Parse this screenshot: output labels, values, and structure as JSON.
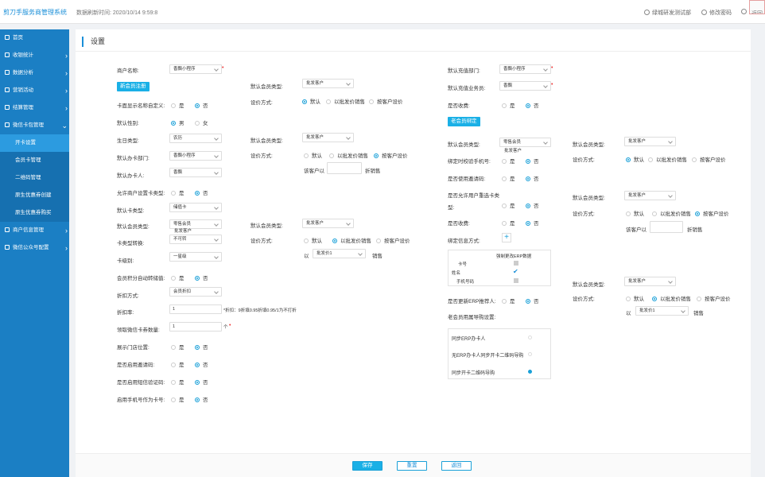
{
  "header": {
    "brand": "剪刀手服务商管理系统",
    "refresh": "数据刷新时间: 2020/10/14 9:59:8",
    "user": "绿城研发测试部",
    "change_pwd": "修改密码",
    "back": "返回"
  },
  "sidebar": {
    "items": [
      {
        "label": "首页"
      },
      {
        "label": "收银统计"
      },
      {
        "label": "数据分析"
      },
      {
        "label": "营销活动"
      },
      {
        "label": "结算管理"
      },
      {
        "label": "微信卡包管理"
      },
      {
        "label": "开卡设置"
      },
      {
        "label": "会员卡管理"
      },
      {
        "label": "二维码管理"
      },
      {
        "label": "原生优惠券创建"
      },
      {
        "label": "原生优惠券购买"
      },
      {
        "label": "商户信息管理"
      },
      {
        "label": "微信公众号配置"
      }
    ]
  },
  "page": {
    "title": "设置"
  },
  "form": {
    "c1": {
      "merchant_label": "商户名称:",
      "merchant_value": "香飘小程序",
      "new_member_tag": "新会员注册",
      "custom_title_label": "卡面显示名称自定义:",
      "yes": "是",
      "no": "否",
      "gender_label": "默认性别:",
      "male": "男",
      "female": "女",
      "birthday_label": "生日类型:",
      "birthday_value": "农历",
      "dept_label": "默认办卡部门:",
      "dept_value": "香飘小程序",
      "person_label": "默认办卡人:",
      "person_value": "香飘",
      "allow_type_label": "允许商户设置卡类型:",
      "card_type_label": "默认卡类型:",
      "card_type_value": "储值卡",
      "member_type_label": "默认会员类型:",
      "member_type_value": "零售会员",
      "member_type_overlay": "批发客户",
      "card_convert_label": "卡类型转换:",
      "card_convert_value": "不可转",
      "card_level_label": "卡级别:",
      "card_level_value": "一星级",
      "points_label": "会员积分自动转储值:",
      "discount_mode_label": "折扣方式:",
      "discount_mode_value": "会员折扣",
      "discount_rate_label": "折扣率:",
      "discount_rate_value": "1",
      "discount_rate_hint": "*折扣：9折填0.95折填0.95/1为不打折",
      "wx_count_label": "领取微信卡券数量:",
      "wx_count_value": "1",
      "wx_count_unit": "个",
      "show_store_label": "展示门店位置:",
      "invite_label": "是否启用邀请码:",
      "sms_label": "是否启用短信验证码:",
      "phone_card_label": "启用手机号作为卡号:"
    },
    "c2": {
      "mt_label": "默认会员类型:",
      "mt_value": "批发客户",
      "price_label": "设价方式:",
      "opt_default": "默认",
      "opt_wholesale": "以批发价销售",
      "opt_customer": "按客户设价",
      "by_customer_prefix": "该客户以",
      "discount_suffix": "折销售",
      "to_label": "以",
      "to_value": "批发价1",
      "sale_suffix": "销售"
    },
    "c3": {
      "dept_label": "默认充值部门:",
      "dept_value": "香飘小程序",
      "staff_label": "默认充值业务员:",
      "staff_value": "香飘",
      "fee_label": "是否收费:",
      "old_member_tag": "老会员绑定",
      "mt_label": "默认会员类型:",
      "mt_value": "零售会员",
      "mt_overlay": "批发客户",
      "bind_phone_label": "绑定时校验手机号:",
      "invite_label": "是否使用邀请码:",
      "allow_select_label": "是否允许用户重选卡类型:",
      "fee2_label": "是否收费:",
      "bind_info_label": "绑定信息方式:",
      "erp_title": "强制更改ERP数据",
      "erp_rows": [
        "卡号",
        "姓名",
        "手机号码"
      ],
      "erp_update_label": "是否更新ERP推荐人:",
      "guide_label": "老会员用属导购设置:",
      "guide_options": [
        "同步ERP办卡人",
        "无ERP办卡人同步开卡二维码导购",
        "同步开卡二维码导购"
      ]
    },
    "c4": {
      "mt_label": "默认会员类型:",
      "mt_value": "批发客户",
      "price_label": "设价方式:"
    }
  },
  "footer": {
    "save": "保存",
    "reset": "重置",
    "back": "返回"
  }
}
